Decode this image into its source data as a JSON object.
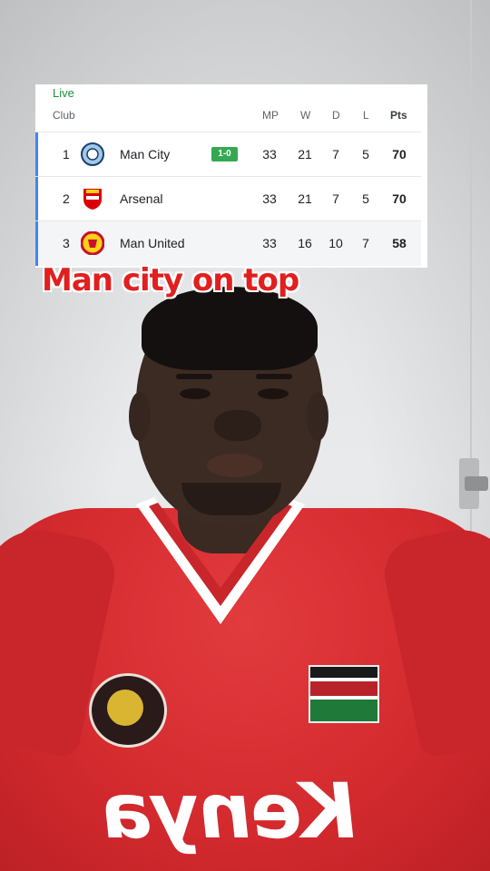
{
  "standings": {
    "status": "Live",
    "columns": {
      "club": "Club",
      "mp": "MP",
      "w": "W",
      "d": "D",
      "l": "L",
      "pts": "Pts"
    },
    "rows": [
      {
        "pos": "1",
        "club": "Man City",
        "live_score": "1-0",
        "mp": "33",
        "w": "21",
        "d": "7",
        "l": "5",
        "pts": "70",
        "logo": "man-city-crest"
      },
      {
        "pos": "2",
        "club": "Arsenal",
        "live_score": "",
        "mp": "33",
        "w": "21",
        "d": "7",
        "l": "5",
        "pts": "70",
        "logo": "arsenal-crest"
      },
      {
        "pos": "3",
        "club": "Man United",
        "live_score": "",
        "mp": "33",
        "w": "16",
        "d": "10",
        "l": "7",
        "pts": "58",
        "logo": "man-united-crest"
      }
    ],
    "accent_color": "#4285f4",
    "live_color": "#1e8e3e"
  },
  "caption": "Man city on top",
  "jersey": {
    "text": "Kenya",
    "crest": "kenya-football-federation-crest",
    "flag": "kenya-flag"
  }
}
